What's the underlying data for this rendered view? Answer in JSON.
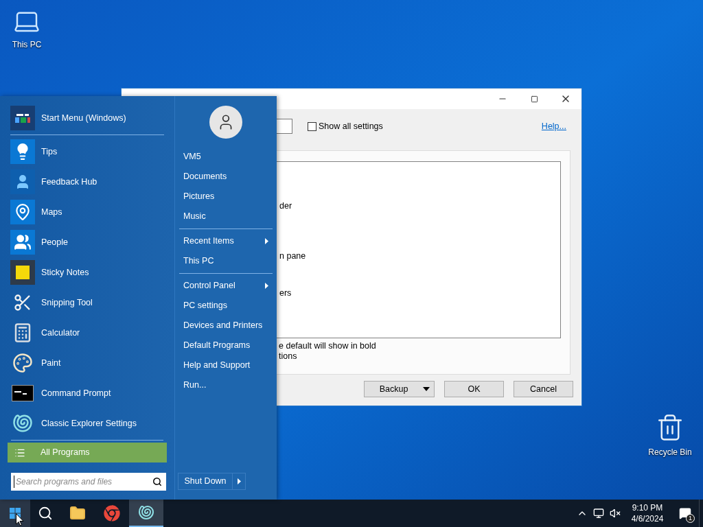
{
  "desktop_icons": [
    {
      "label": "This PC"
    },
    {
      "label": "Recycle Bin"
    }
  ],
  "window": {
    "show_all_settings": {
      "label": "Show all settings",
      "checked": false
    },
    "help_link": "Help...",
    "list_fragments": [
      "der",
      "n pane",
      "ers"
    ],
    "notes": [
      "e default will show in bold",
      "tions"
    ],
    "buttons": [
      {
        "label": "Backup",
        "kind": "split"
      },
      {
        "label": "OK",
        "kind": "plain"
      },
      {
        "label": "Cancel",
        "kind": "plain"
      }
    ]
  },
  "start_menu": {
    "programs": [
      {
        "label": "Start Menu (Windows)"
      },
      {
        "label": "Tips"
      },
      {
        "label": "Feedback Hub"
      },
      {
        "label": "Maps"
      },
      {
        "label": "People"
      },
      {
        "label": "Sticky Notes"
      },
      {
        "label": "Snipping Tool"
      },
      {
        "label": "Calculator"
      },
      {
        "label": "Paint"
      },
      {
        "label": "Command Prompt"
      },
      {
        "label": "Classic Explorer Settings"
      }
    ],
    "all_programs": "All Programs",
    "search": {
      "placeholder": "Search programs and files"
    },
    "places": [
      {
        "items": [
          {
            "label": "VM5",
            "submenu": false
          },
          {
            "label": "Documents",
            "submenu": false
          },
          {
            "label": "Pictures",
            "submenu": false
          },
          {
            "label": "Music",
            "submenu": false
          }
        ]
      },
      {
        "items": [
          {
            "label": "Recent Items",
            "submenu": true
          },
          {
            "label": "This PC",
            "submenu": false
          }
        ]
      },
      {
        "items": [
          {
            "label": "Control Panel",
            "submenu": true
          },
          {
            "label": "PC settings",
            "submenu": false
          },
          {
            "label": "Devices and Printers",
            "submenu": false
          },
          {
            "label": "Default Programs",
            "submenu": false
          },
          {
            "label": "Help and Support",
            "submenu": false
          },
          {
            "label": "Run...",
            "submenu": false
          }
        ]
      }
    ],
    "shut_down": "Shut Down"
  },
  "taskbar": {
    "start_hovered": true,
    "apps": [
      {
        "active": false
      },
      {
        "active": false
      },
      {
        "active": false
      },
      {
        "active": true
      }
    ],
    "time": "9:10 PM",
    "date": "4/6/2024",
    "notification_count": "1"
  }
}
